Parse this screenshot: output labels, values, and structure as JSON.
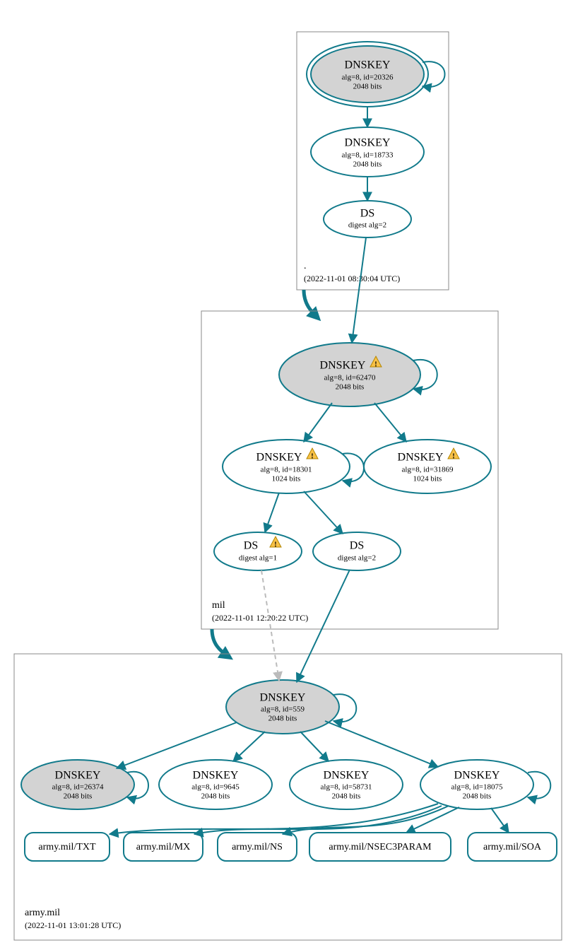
{
  "zones": {
    "root": {
      "label": ".",
      "timestamp": "(2022-11-01 08:30:04 UTC)",
      "nodes": {
        "ksk": {
          "title": "DNSKEY",
          "sub1": "alg=8, id=20326",
          "sub2": "2048 bits"
        },
        "zsk": {
          "title": "DNSKEY",
          "sub1": "alg=8, id=18733",
          "sub2": "2048 bits"
        },
        "ds": {
          "title": "DS",
          "sub1": "digest alg=2"
        }
      }
    },
    "mil": {
      "label": "mil",
      "timestamp": "(2022-11-01 12:20:22 UTC)",
      "nodes": {
        "ksk": {
          "title": "DNSKEY",
          "sub1": "alg=8, id=62470",
          "sub2": "2048 bits",
          "warn": true
        },
        "zsk1": {
          "title": "DNSKEY",
          "sub1": "alg=8, id=18301",
          "sub2": "1024 bits",
          "warn": true
        },
        "zsk2": {
          "title": "DNSKEY",
          "sub1": "alg=8, id=31869",
          "sub2": "1024 bits",
          "warn": true
        },
        "ds1": {
          "title": "DS",
          "sub1": "digest alg=1",
          "warn": true
        },
        "ds2": {
          "title": "DS",
          "sub1": "digest alg=2"
        }
      }
    },
    "army": {
      "label": "army.mil",
      "timestamp": "(2022-11-01 13:01:28 UTC)",
      "nodes": {
        "ksk": {
          "title": "DNSKEY",
          "sub1": "alg=8, id=559",
          "sub2": "2048 bits"
        },
        "k1": {
          "title": "DNSKEY",
          "sub1": "alg=8, id=26374",
          "sub2": "2048 bits"
        },
        "k2": {
          "title": "DNSKEY",
          "sub1": "alg=8, id=9645",
          "sub2": "2048 bits"
        },
        "k3": {
          "title": "DNSKEY",
          "sub1": "alg=8, id=58731",
          "sub2": "2048 bits"
        },
        "k4": {
          "title": "DNSKEY",
          "sub1": "alg=8, id=18075",
          "sub2": "2048 bits"
        }
      },
      "records": {
        "txt": "army.mil/TXT",
        "mx": "army.mil/MX",
        "ns": "army.mil/NS",
        "nsec3": "army.mil/NSEC3PARAM",
        "soa": "army.mil/SOA"
      }
    }
  }
}
